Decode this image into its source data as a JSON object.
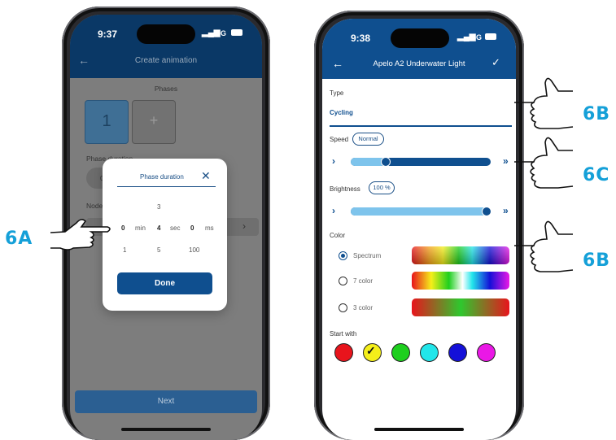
{
  "colors": {
    "brand_blue": "#0f4f8f",
    "accent_cyan": "#15a0d8",
    "slider_light": "#7ec4ec"
  },
  "left_phone": {
    "status_time": "9:37",
    "status_signal": "5G",
    "appbar": {
      "back_icon": "arrow-left-icon",
      "title": "Create animation"
    },
    "phases_label": "Phases",
    "phase_tile": "1",
    "add_phase_tile": "+",
    "phase_duration_label": "Phase duration",
    "duration_chip": "0 m",
    "nodes_label": "Nodes",
    "dialog": {
      "title": "Phase duration",
      "close_icon": "close-icon",
      "picker": {
        "above": "3",
        "minutes_value": "0",
        "minutes_unit": "min",
        "seconds_value": "4",
        "seconds_unit": "sec",
        "ms_value": "0",
        "ms_unit": "ms",
        "below_min": "1",
        "below_sec": "5",
        "below_ms": "100"
      },
      "done_label": "Done"
    },
    "next_label": "Next"
  },
  "right_phone": {
    "status_time": "9:38",
    "status_signal": "5G",
    "appbar": {
      "back_icon": "arrow-left-icon",
      "title": "Apelo A2 Underwater Light",
      "confirm_icon": "check-icon"
    },
    "type_label": "Type",
    "type_value": "Cycling",
    "speed_label": "Speed",
    "speed_value": "Normal",
    "speed_level": 0.25,
    "brightness_label": "Brightness",
    "brightness_value": "100 %",
    "brightness_level": 1.0,
    "color_label": "Color",
    "color_options": [
      {
        "label": "Spectrum",
        "selected": true
      },
      {
        "label": "7 color",
        "selected": false
      },
      {
        "label": "3 color",
        "selected": false
      }
    ],
    "start_with_label": "Start with",
    "start_colors": [
      "#e8141c",
      "#f5ef1a",
      "#1ecf1e",
      "#22e6ea",
      "#1410d8",
      "#ea18e6"
    ],
    "start_selected_index": 1
  },
  "callouts": {
    "left": "6A",
    "right_top": "6B",
    "right_mid": "6C",
    "right_bottom": "6B"
  }
}
